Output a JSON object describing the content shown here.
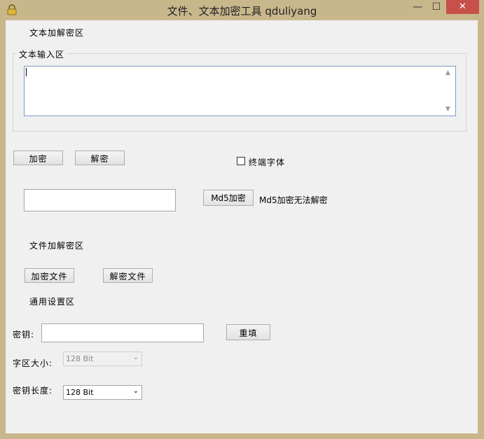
{
  "window": {
    "title": "文件、文本加密工具  qduliyang",
    "minimize_icon": "minimize-icon",
    "maximize_icon": "maximize-icon",
    "close_icon": "close-icon",
    "app_icon": "lock-icon",
    "minimize_glyph": "—",
    "maximize_glyph": "☐",
    "close_glyph": "✕",
    "close_color": "#c7504a"
  },
  "text_section": {
    "heading": "文本加解密区",
    "group_label": "文本输入区",
    "textarea_value": "",
    "encrypt_button": "加密",
    "decrypt_button": "解密",
    "terminal_font_label": "终端字体",
    "terminal_font_checked": false
  },
  "md5": {
    "input_value": "",
    "button": "Md5加密",
    "note": "Md5加密无法解密"
  },
  "file_section": {
    "heading": "文件加解密区",
    "encrypt_file_button": "加密文件",
    "decrypt_file_button": "解密文件"
  },
  "settings": {
    "heading": "通用设置区",
    "key_label": "密钥:",
    "key_value": "",
    "reset_button": "重填",
    "block_size_label": "字区大小:",
    "block_size_value": "128 Bit",
    "key_length_label": "密钥长度:",
    "key_length_value": "128 Bit"
  }
}
